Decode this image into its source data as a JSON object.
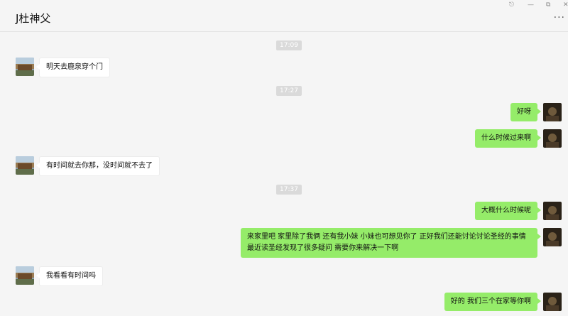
{
  "chat": {
    "title": "J杜神父"
  },
  "window_controls": {
    "pin_icon": "pin-icon",
    "minimize_icon": "minimize-icon",
    "restore_icon": "restore-icon",
    "close_icon": "close-icon",
    "more_icon": "more-options-icon"
  },
  "timestamps": [
    "17:09",
    "17:27",
    "17:37"
  ],
  "messages": [
    {
      "side": "in",
      "text": "明天去鹿泉穿个门"
    },
    {
      "side": "out",
      "text": "好呀"
    },
    {
      "side": "out",
      "text": "什么时候过来啊"
    },
    {
      "side": "in",
      "text": "有时间就去你那，没时间就不去了"
    },
    {
      "side": "out",
      "text": "大概什么时候呢"
    },
    {
      "side": "out",
      "text": "来家里吧 家里除了我俩 还有我小妹 小妹也可想见你了 正好我们还能讨论讨论圣经的事情  最近读圣经发现了很多疑问 需要你来解决一下啊"
    },
    {
      "side": "in",
      "text": "我看看有时间吗"
    },
    {
      "side": "out",
      "text": "好的  我们三个在家等你啊"
    }
  ],
  "colors": {
    "outgoing_bubble": "#95ec69",
    "incoming_bubble": "#ffffff",
    "background": "#f5f5f5",
    "timestamp_bg": "#dadada"
  }
}
